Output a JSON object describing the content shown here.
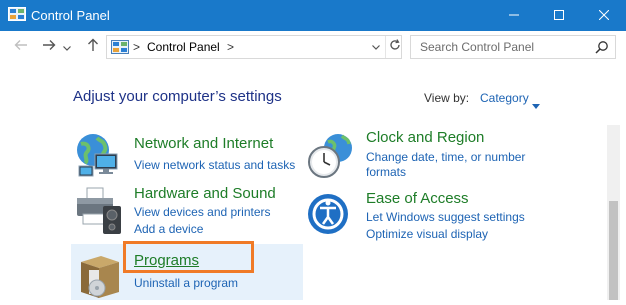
{
  "window": {
    "title": "Control Panel",
    "icons": {
      "app": "control-panel-icon",
      "minimize": "minimize-icon",
      "maximize": "maximize-icon",
      "close": "close-icon"
    }
  },
  "nav": {
    "back_icon": "back-arrow-icon",
    "forward_icon": "forward-arrow-icon",
    "recent_icon": "chevron-down-icon",
    "up_icon": "up-arrow-icon"
  },
  "address": {
    "separator": ">",
    "path": "Control Panel",
    "trailing_separator": ">"
  },
  "search": {
    "placeholder": "Search Control Panel",
    "icon": "search-icon"
  },
  "content": {
    "heading": "Adjust your computer’s settings",
    "view_by_label": "View by:",
    "view_by_value": "Category"
  },
  "categories": [
    {
      "title": "Network and Internet",
      "links": [
        "View network status and tasks"
      ],
      "icon": "network-globe-icon"
    },
    {
      "title": "Hardware and Sound",
      "links": [
        "View devices and printers",
        "Add a device"
      ],
      "icon": "printer-icon"
    },
    {
      "title": "Programs",
      "links": [
        "Uninstall a program"
      ],
      "icon": "programs-box-icon"
    },
    {
      "title": "Clock and Region",
      "links": [
        "Change date, time, or number",
        "formats"
      ],
      "icon": "clock-globe-icon"
    },
    {
      "title": "Ease of Access",
      "links": [
        "Let Windows suggest settings",
        "Optimize visual display"
      ],
      "icon": "ease-of-access-icon"
    }
  ],
  "colors": {
    "titlebar": "#1979ca",
    "heading": "#1e3287",
    "category_title": "#1e7d28",
    "link": "#1e64b4",
    "highlight_border": "#f07a26",
    "selected_background": "#e6f1fb"
  }
}
